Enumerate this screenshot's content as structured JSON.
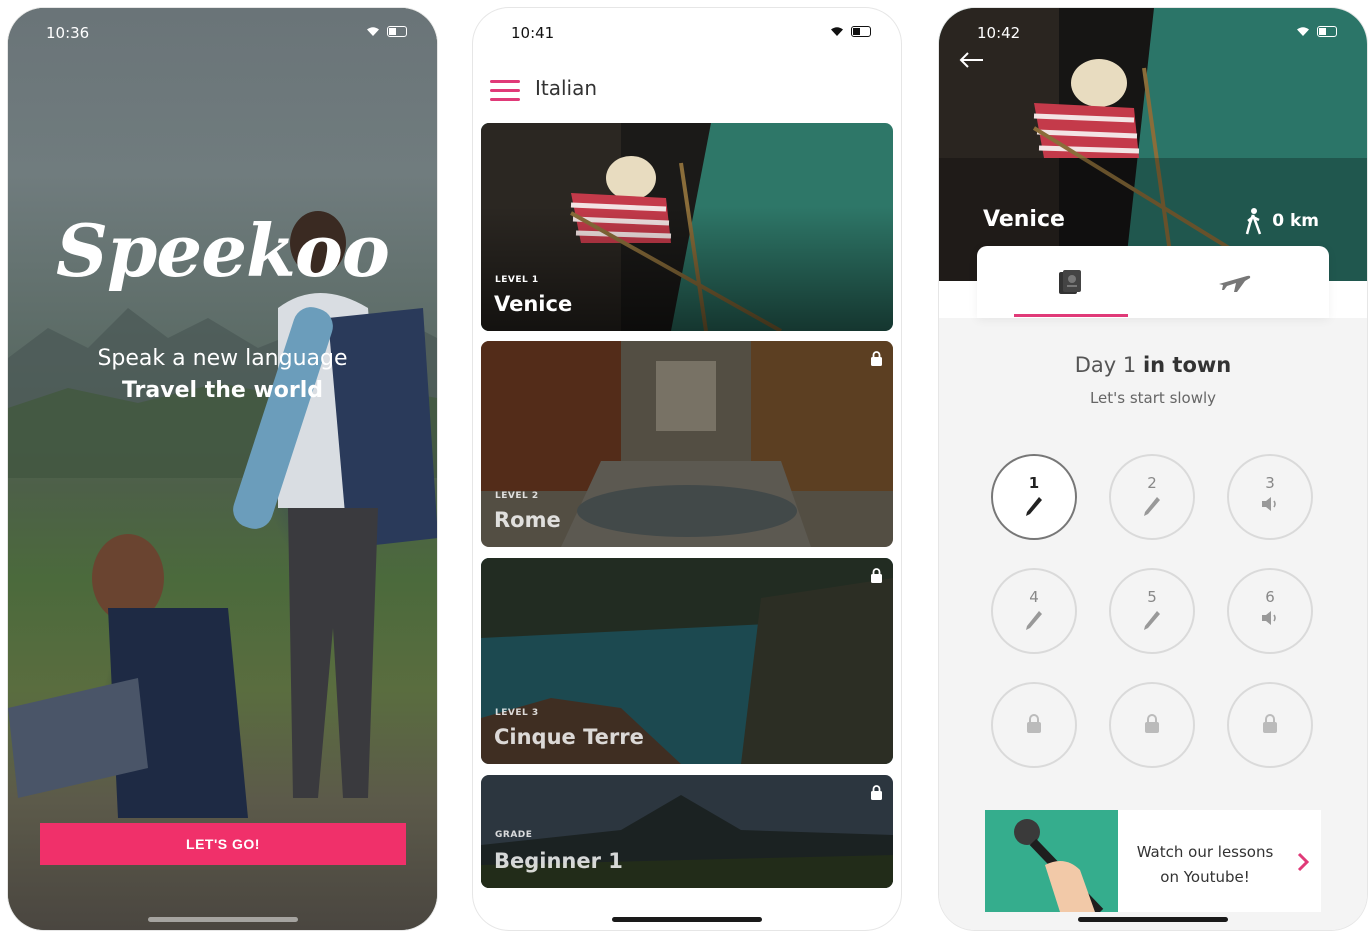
{
  "screen1": {
    "status_time": "10:36",
    "logo": "Speekoo",
    "tagline_1": "Speak a new language",
    "tagline_2": "Travel the world",
    "cta_label": "LET'S GO!"
  },
  "screen2": {
    "status_time": "10:41",
    "header_title": "Italian",
    "cards": [
      {
        "level": "LEVEL 1",
        "name": "Venice",
        "locked": false
      },
      {
        "level": "LEVEL 2",
        "name": "Rome",
        "locked": true
      },
      {
        "level": "LEVEL 3",
        "name": "Cinque Terre",
        "locked": true
      },
      {
        "level": "GRADE",
        "name": "Beginner 1",
        "locked": true
      }
    ]
  },
  "screen3": {
    "status_time": "10:42",
    "hero_title": "Venice",
    "distance": "0 km",
    "day_prefix": "Day 1",
    "day_suffix": "in town",
    "day_subtitle": "Let's start slowly",
    "lessons": [
      {
        "number": "1",
        "icon": "pencil-icon",
        "state": "active"
      },
      {
        "number": "2",
        "icon": "pencil-icon",
        "state": "open"
      },
      {
        "number": "3",
        "icon": "speaker-icon",
        "state": "open"
      },
      {
        "number": "4",
        "icon": "pencil-icon",
        "state": "open"
      },
      {
        "number": "5",
        "icon": "pencil-icon",
        "state": "open"
      },
      {
        "number": "6",
        "icon": "speaker-icon",
        "state": "open"
      },
      {
        "number": "",
        "icon": "lock-icon",
        "state": "locked"
      },
      {
        "number": "",
        "icon": "lock-icon",
        "state": "locked"
      },
      {
        "number": "",
        "icon": "lock-icon",
        "state": "locked"
      }
    ],
    "youtube_line_1": "Watch our lessons",
    "youtube_line_2": "on Youtube!"
  },
  "colors": {
    "accent_pink": "#f0306a",
    "accent_magenta": "#e03a78",
    "teal": "#35ad8d"
  }
}
